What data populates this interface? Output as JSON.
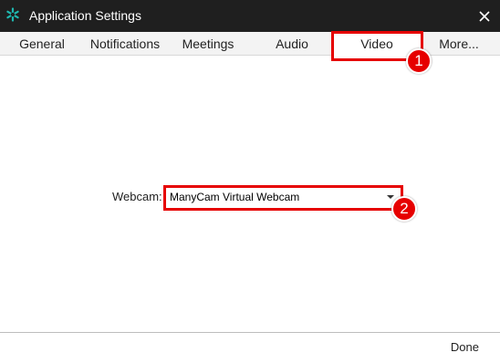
{
  "window": {
    "title": "Application Settings",
    "app_icon": "gear-snowflake-icon",
    "close_icon": "close-icon"
  },
  "tabs": [
    {
      "label": "General",
      "active": false
    },
    {
      "label": "Notifications",
      "active": false
    },
    {
      "label": "Meetings",
      "active": false
    },
    {
      "label": "Audio",
      "active": false
    },
    {
      "label": "Video",
      "active": true
    },
    {
      "label": "More...",
      "active": false
    }
  ],
  "video": {
    "webcam_label": "Webcam:",
    "webcam_value": "ManyCam Virtual Webcam"
  },
  "footer": {
    "done_label": "Done"
  },
  "annotations": {
    "step1": "1",
    "step2": "2",
    "color": "#e60000"
  },
  "colors": {
    "titlebar": "#1f1f1f",
    "app_icon": "#1fb8b0",
    "tabbar": "#f3f3f3"
  }
}
